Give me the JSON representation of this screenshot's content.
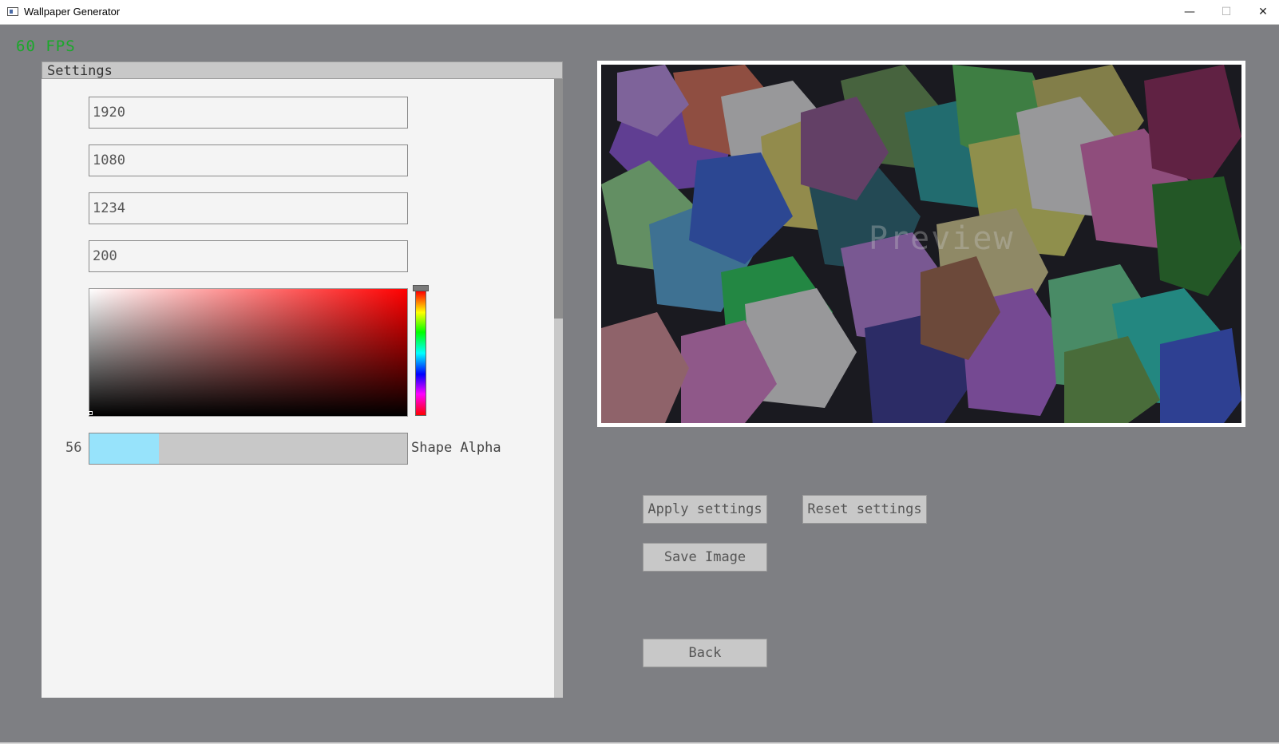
{
  "window": {
    "title": "Wallpaper Generator",
    "minimize_glyph": "—",
    "maximize_glyph": "☐",
    "close_glyph": "✕"
  },
  "fps": "60 FPS",
  "settings": {
    "title": "Settings",
    "fields": [
      "1920",
      "1080",
      "1234",
      "200"
    ],
    "color_picker": {
      "base_hue": "#ff0000",
      "selected": "#000000"
    },
    "shape_alpha": {
      "value": "56",
      "label": "Shape Alpha",
      "fraction": 0.219,
      "fill_color": "#97e3fb"
    }
  },
  "preview": {
    "label": "Preview"
  },
  "buttons": {
    "apply": "Apply settings",
    "reset": "Reset settings",
    "save": "Save Image",
    "back": "Back"
  },
  "colors": {
    "background": "#7e7f83",
    "fps_green": "#1aa82a",
    "panel": "#f4f4f4"
  }
}
